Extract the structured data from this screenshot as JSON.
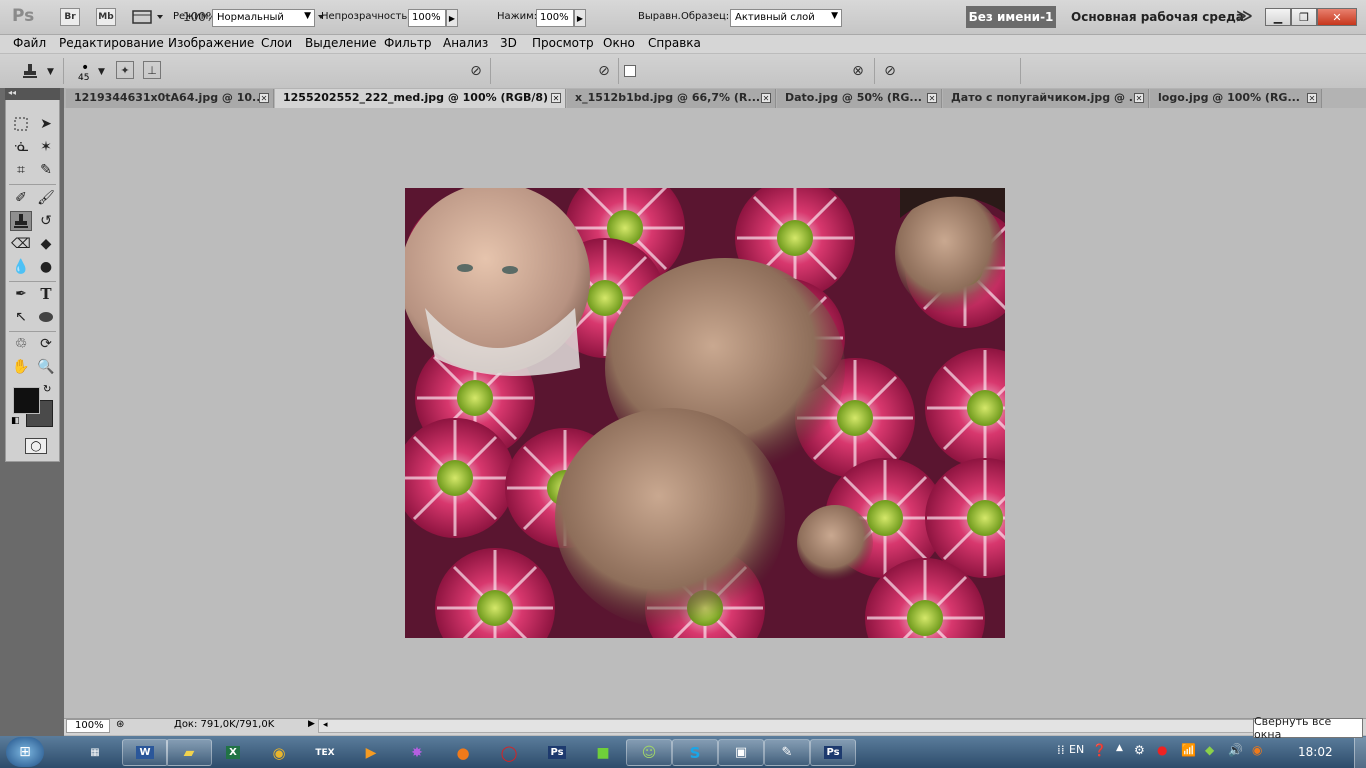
{
  "app": {
    "logo": "Ps",
    "br_label": "Br",
    "mb_label": "Mb",
    "zoom": "100%",
    "document_title": "Без имени-1",
    "workspace": "Основная рабочая среда",
    "chevrons": "≫"
  },
  "menu": [
    "Файл",
    "Редактирование",
    "Изображение",
    "Слои",
    "Выделение",
    "Фильтр",
    "Анализ",
    "3D",
    "Просмотр",
    "Окно",
    "Справка"
  ],
  "options": {
    "brush_size": "45",
    "mode_label": "Режим:",
    "mode_value": "Нормальный",
    "opacity_label": "Непрозрачность:",
    "opacity_value": "100%",
    "flow_label": "Нажим:",
    "flow_value": "100%",
    "aligned_label": "Выравн.",
    "sample_label": "Образец:",
    "sample_value": "Активный слой"
  },
  "tabs": [
    {
      "label": "1219344631x0tA64.jpg @ 10..."
    },
    {
      "label": "1255202552_222_med.jpg @ 100% (RGB/8) *"
    },
    {
      "label": "x_1512b1bd.jpg @ 66,7% (R..."
    },
    {
      "label": "Dato.jpg @ 50% (RG..."
    },
    {
      "label": "Дато с попугайчиком.jpg @ ..."
    },
    {
      "label": "logo.jpg @ 100% (RG..."
    }
  ],
  "status": {
    "zoom": "100%",
    "doc": "Док: 791,0K/791,0K"
  },
  "taskbar": {
    "lang": "EN",
    "time": "18:02",
    "tooltip": "Свернуть все окна"
  },
  "colors": {
    "foreground": "#101010",
    "background": "#4a4a4a",
    "flower_pink": "#c8275f",
    "flower_center": "#8fb82a"
  }
}
